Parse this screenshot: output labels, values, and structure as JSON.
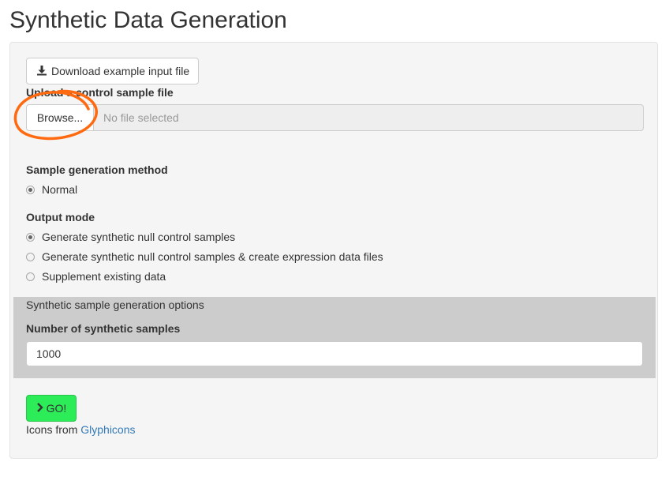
{
  "page": {
    "title": "Synthetic Data Generation"
  },
  "download": {
    "label": "Download example input file",
    "icon": "download-icon"
  },
  "upload": {
    "label": "Upload a control sample file",
    "browse_label": "Browse...",
    "file_status": "No file selected"
  },
  "method": {
    "label": "Sample generation method",
    "options": [
      {
        "label": "Normal",
        "selected": true
      }
    ]
  },
  "output": {
    "label": "Output mode",
    "options": [
      {
        "label": "Generate synthetic null control samples",
        "selected": true
      },
      {
        "label": "Generate synthetic null control samples & create expression data files",
        "selected": false
      },
      {
        "label": "Supplement existing data",
        "selected": false
      }
    ]
  },
  "options_section": {
    "heading": "Synthetic sample generation options",
    "samples_label": "Number of synthetic samples",
    "samples_value": "1000"
  },
  "go": {
    "label": "GO!",
    "icon": "chevron-right-icon"
  },
  "credit": {
    "prefix": "Icons from ",
    "link": "Glyphicons"
  },
  "annotation": {
    "color": "#ff6600",
    "shape": "hand-drawn-circle"
  }
}
